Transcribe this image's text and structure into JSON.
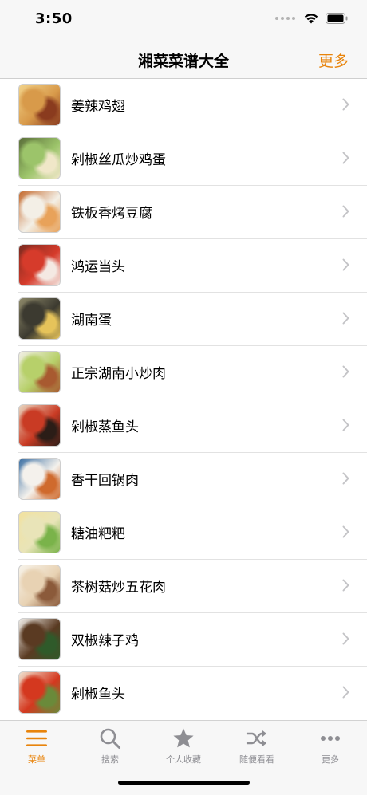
{
  "status": {
    "time": "3:50"
  },
  "nav": {
    "title": "湘菜菜谱大全",
    "more_label": "更多"
  },
  "recipes": [
    {
      "name": "姜辣鸡翅",
      "colors": [
        "#d89a4a",
        "#8a3b1e",
        "#f2d38a"
      ]
    },
    {
      "name": "剁椒丝瓜炒鸡蛋",
      "colors": [
        "#9cc46a",
        "#f0e7c8",
        "#5b6f3a"
      ]
    },
    {
      "name": "铁板香烤豆腐",
      "colors": [
        "#f3efe6",
        "#e8a25a",
        "#c46a2e"
      ]
    },
    {
      "name": "鸿运当头",
      "colors": [
        "#d63b2b",
        "#f4e9e3",
        "#7a2a1f"
      ]
    },
    {
      "name": "湖南蛋",
      "colors": [
        "#3c3a30",
        "#e6c35a",
        "#8f8a6a"
      ]
    },
    {
      "name": "正宗湖南小炒肉",
      "colors": [
        "#b7d06a",
        "#a85a30",
        "#f2efe6"
      ]
    },
    {
      "name": "剁椒蒸鱼头",
      "colors": [
        "#c93b24",
        "#2b1d17",
        "#e9d6c0"
      ]
    },
    {
      "name": "香干回锅肉",
      "colors": [
        "#f4f1ec",
        "#cf6a2d",
        "#3b6fa3"
      ]
    },
    {
      "name": "糖油粑粑",
      "colors": [
        "#e9e4b8",
        "#7ab34a",
        "#f2e2a0"
      ]
    },
    {
      "name": "茶树菇炒五花肉",
      "colors": [
        "#e8d2b3",
        "#8b5a3a",
        "#f7f3ea"
      ]
    },
    {
      "name": "双椒辣子鸡",
      "colors": [
        "#5a3a22",
        "#2f5a2a",
        "#f2efea"
      ]
    },
    {
      "name": "剁椒鱼头",
      "colors": [
        "#d4381f",
        "#6a8a3a",
        "#f0e2cf"
      ]
    }
  ],
  "tabs": [
    {
      "label": "菜单",
      "icon": "menu-icon",
      "active": true
    },
    {
      "label": "搜索",
      "icon": "search-icon",
      "active": false
    },
    {
      "label": "个人收藏",
      "icon": "star-icon",
      "active": false
    },
    {
      "label": "随便看看",
      "icon": "shuffle-icon",
      "active": false
    },
    {
      "label": "更多",
      "icon": "more-dots-icon",
      "active": false
    }
  ],
  "colors": {
    "accent": "#e8840c",
    "inactive": "#8e8e93",
    "bar_bg": "#f7f7f7"
  }
}
